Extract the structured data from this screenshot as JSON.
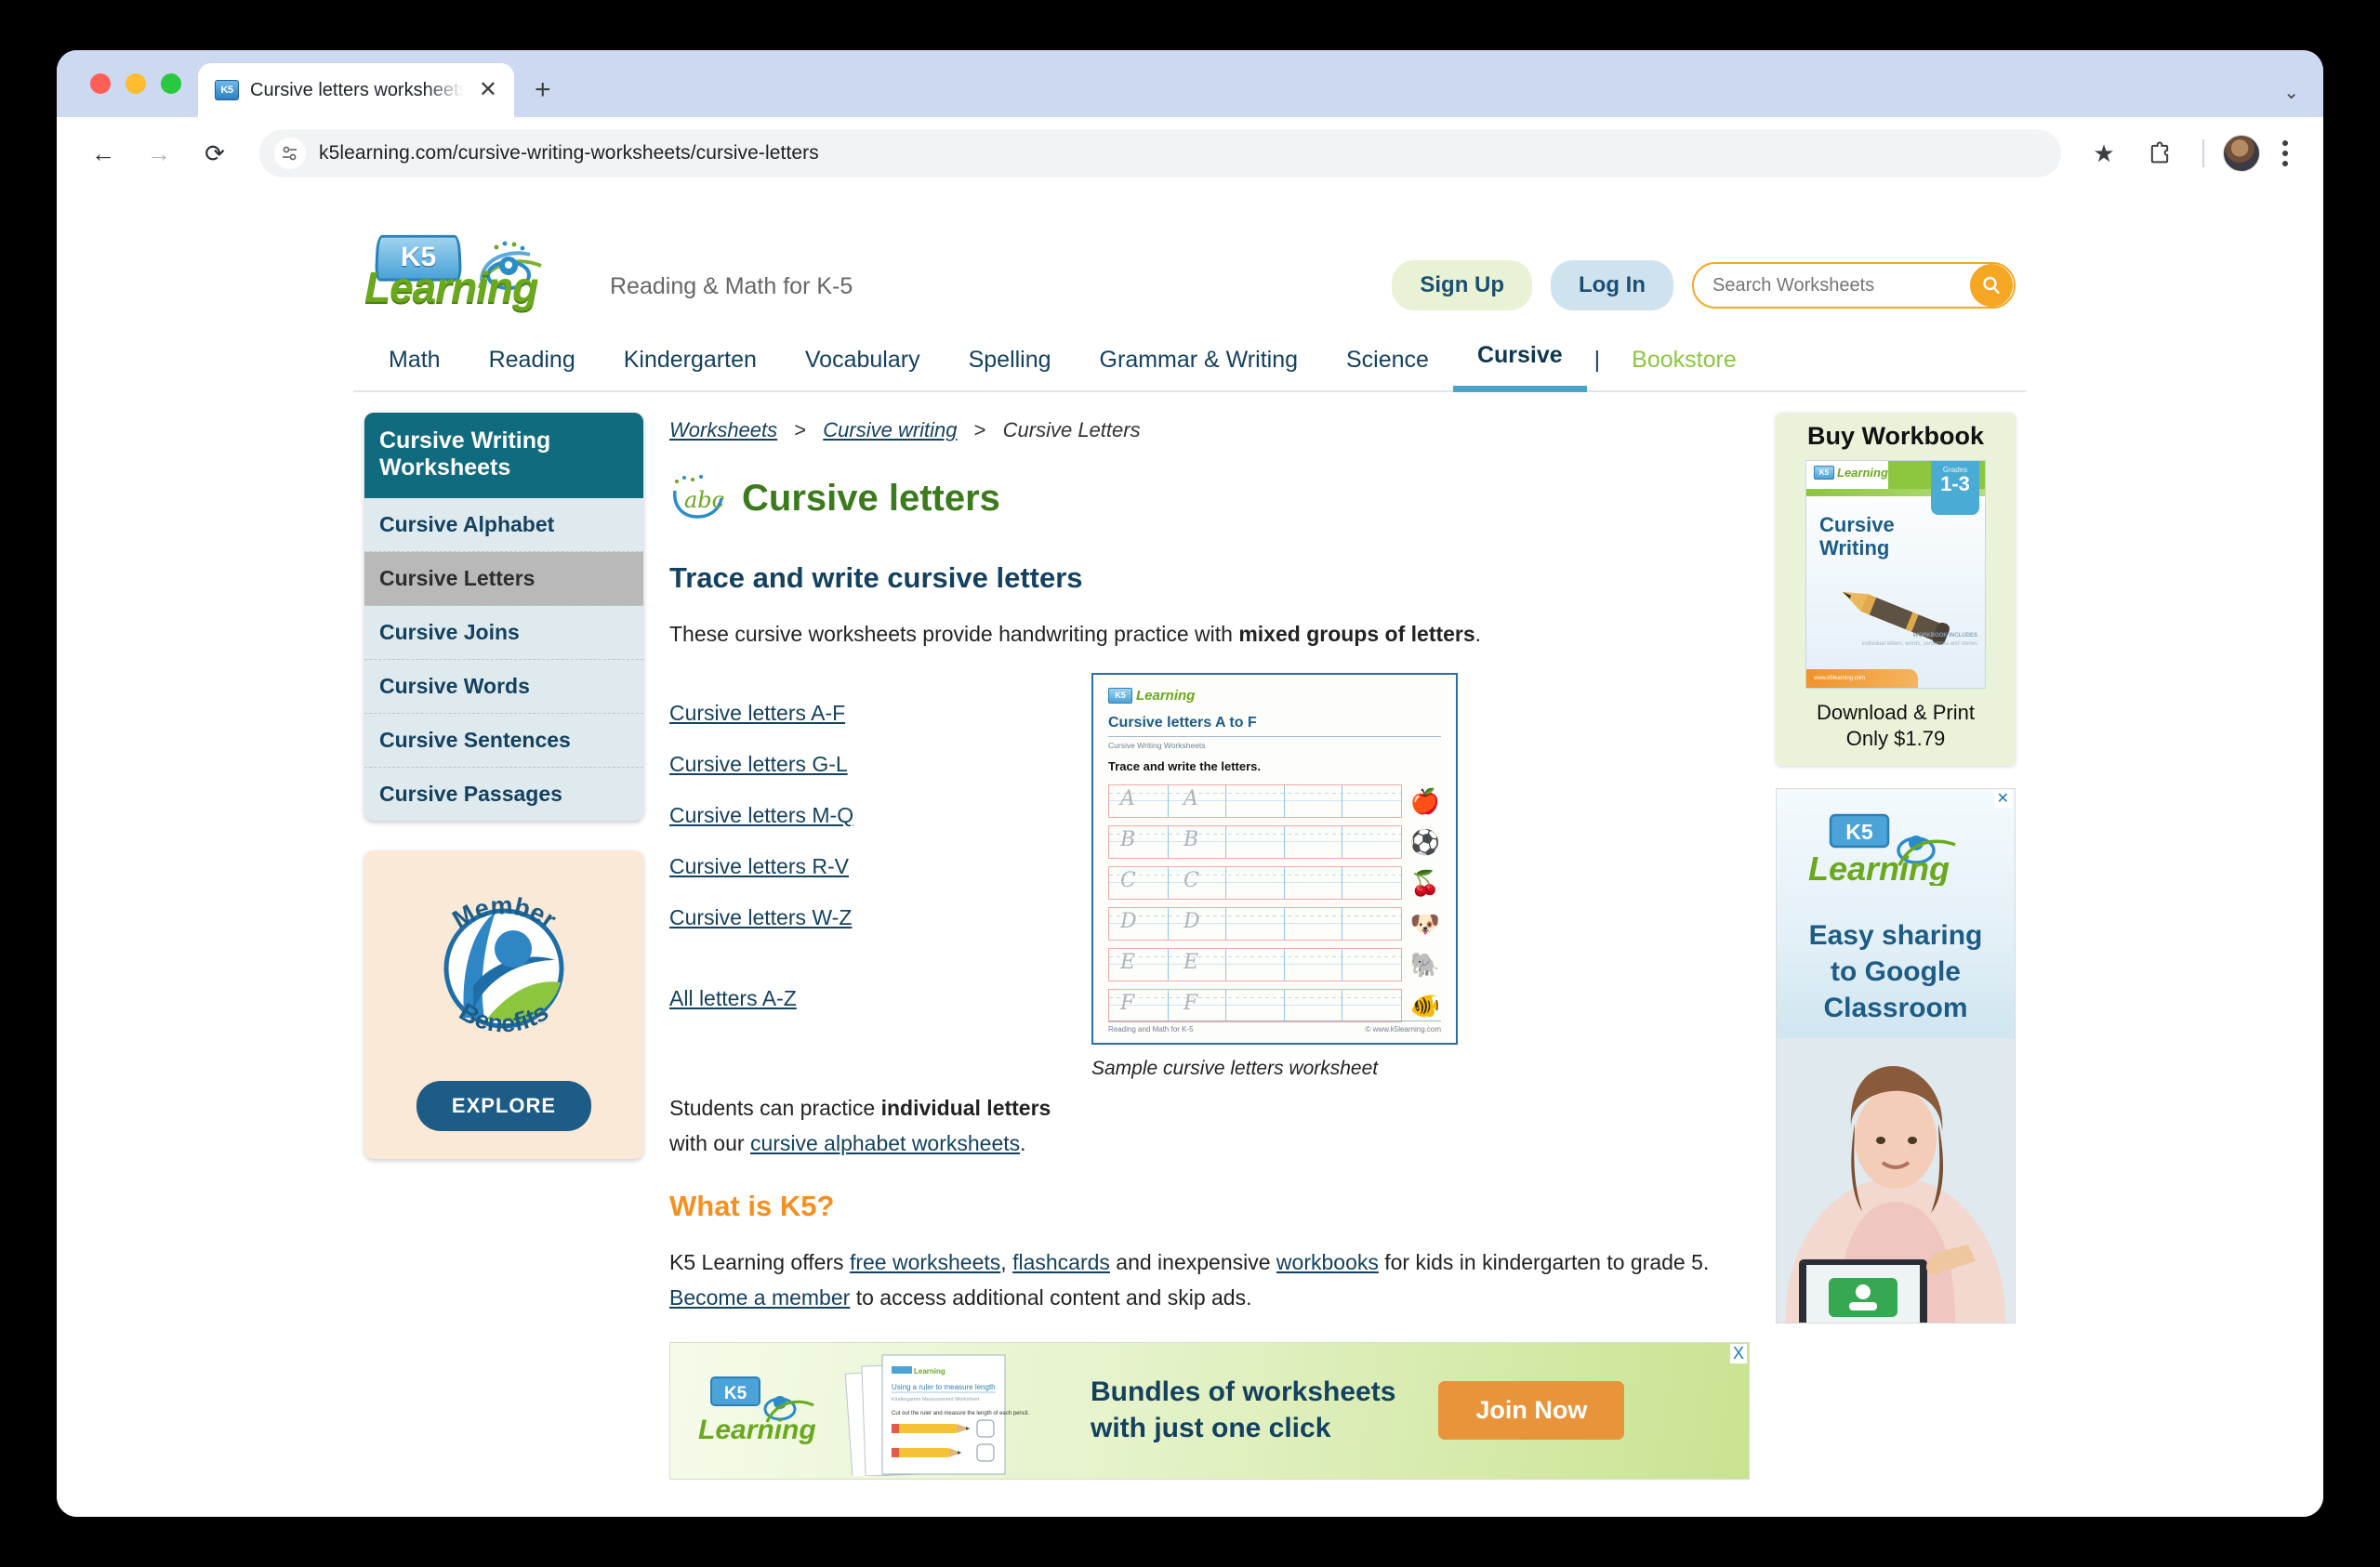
{
  "browser": {
    "tab": {
      "title": "Cursive letters worksheets | K",
      "favicon": "k5-book-icon",
      "close": "✕"
    },
    "newtab_label": "+",
    "tabstrip_menu": "⌄",
    "back": "←",
    "forward": "→",
    "reload": "⟳",
    "url": "k5learning.com/cursive-writing-worksheets/cursive-letters",
    "site_info_icon": "tune-icon",
    "bookmark_icon": "★",
    "extensions_icon": "puzzle-icon",
    "profile_icon": "avatar",
    "menu_icon": "kebab-menu"
  },
  "site": {
    "logo_k5": "K5",
    "logo_word": "Learning",
    "tagline": "Reading & Math for K-5",
    "signup": "Sign Up",
    "login": "Log In",
    "search_placeholder": "Search Worksheets",
    "search_value": "",
    "search_icon": "search-icon"
  },
  "nav": {
    "items": [
      {
        "label": "Math",
        "active": false
      },
      {
        "label": "Reading",
        "active": false
      },
      {
        "label": "Kindergarten",
        "active": false
      },
      {
        "label": "Vocabulary",
        "active": false
      },
      {
        "label": "Spelling",
        "active": false
      },
      {
        "label": "Grammar & Writing",
        "active": false
      },
      {
        "label": "Science",
        "active": false
      },
      {
        "label": "Cursive",
        "active": true
      }
    ],
    "separator": "|",
    "bookstore": "Bookstore"
  },
  "sidebar": {
    "heading": "Cursive Writing Worksheets",
    "items": [
      {
        "label": "Cursive Alphabet",
        "active": false
      },
      {
        "label": "Cursive Letters",
        "active": true
      },
      {
        "label": "Cursive Joins",
        "active": false
      },
      {
        "label": "Cursive Words",
        "active": false
      },
      {
        "label": "Cursive Sentences",
        "active": false
      },
      {
        "label": "Cursive Passages",
        "active": false
      }
    ],
    "member": {
      "top_text": "Member",
      "bottom_text": "Benefits",
      "button": "EXPLORE"
    }
  },
  "breadcrumb": {
    "items": [
      "Worksheets",
      "Cursive writing",
      "Cursive Letters"
    ],
    "separator": ">"
  },
  "main": {
    "title": "Cursive letters",
    "title_icon": "abc-icon",
    "subtitle": "Trace and write cursive letters",
    "intro_prefix": "These cursive worksheets provide handwriting practice with ",
    "intro_bold": "mixed groups of letters",
    "intro_suffix": ".",
    "links": [
      "Cursive letters A-F",
      "Cursive letters G-L",
      "Cursive letters M-Q",
      "Cursive letters R-V",
      "Cursive letters W-Z"
    ],
    "all_link": "All letters A-Z",
    "practice_prefix": "Students can practice ",
    "practice_bold": "individual letters",
    "practice_mid": " with our ",
    "practice_link": "cursive alphabet worksheets",
    "practice_suffix": ".",
    "what_is_k5": "What is K5?",
    "k5_text_1": "K5 Learning offers ",
    "k5_link_1": "free worksheets",
    "k5_text_2": ", ",
    "k5_link_2": "flashcards",
    "k5_text_3": " and inexpensive ",
    "k5_link_3": "workbooks",
    "k5_text_4": " for kids in kindergarten to grade 5. ",
    "k5_link_4": "Become a member",
    "k5_text_5": " to access additional content and skip ads."
  },
  "worksheet": {
    "logo_k5": "K5",
    "logo_word": "Learning",
    "title": "Cursive letters A to F",
    "subtitle": "Cursive Writing Worksheets",
    "instruction": "Trace and write the letters.",
    "rows": [
      {
        "letter": "A",
        "picture": "apple-icon",
        "glyph": "🍎"
      },
      {
        "letter": "B",
        "picture": "soccer-ball-icon",
        "glyph": "⚽"
      },
      {
        "letter": "C",
        "picture": "cherries-icon",
        "glyph": "🍒"
      },
      {
        "letter": "D",
        "picture": "dog-icon",
        "glyph": "🐶"
      },
      {
        "letter": "E",
        "picture": "elephant-icon",
        "glyph": "🐘"
      },
      {
        "letter": "F",
        "picture": "fish-icon",
        "glyph": "🐠"
      }
    ],
    "footer_left": "Reading and Math for K-5",
    "footer_right": "© www.k5learning.com",
    "caption": "Sample cursive letters worksheet"
  },
  "buybox": {
    "heading": "Buy Workbook",
    "cover": {
      "logo_k5": "K5",
      "logo_word": "Learning",
      "grades_label": "Grades",
      "grades_value": "1-3",
      "title_line1": "Cursive",
      "title_line2": "Writing",
      "includes_title": "WORKBOOK INCLUDES",
      "includes_lines": "individual letters, words, sentences and stories",
      "url": "www.k5learning.com"
    },
    "caption_line1": "Download & Print",
    "caption_line2": "Only $1.79"
  },
  "side_ad": {
    "close": "✕",
    "logo_k5": "K5",
    "logo_word": "Learning",
    "headline_line1": "Easy sharing",
    "headline_line2": "to Google",
    "headline_line3": "Classroom"
  },
  "banner_ad": {
    "close": "X",
    "logo_k5": "K5",
    "logo_word": "Learning",
    "sheet_logo": "K5 Learning",
    "sheet_title": "Using a ruler to measure length",
    "sheet_sub": "Kindergarten Measurement Worksheet",
    "sheet_instr": "Cut out the ruler and measure the length of each pencil.",
    "headline_line1": "Bundles of worksheets",
    "headline_line2": "with just one click",
    "cta": "Join Now"
  },
  "colors": {
    "teal": "#0f6b7d",
    "navy": "#14415f",
    "green": "#8cc63e",
    "title_green": "#3c7a1e",
    "orange": "#f5a623",
    "accent_underline": "#4ba3c7"
  }
}
